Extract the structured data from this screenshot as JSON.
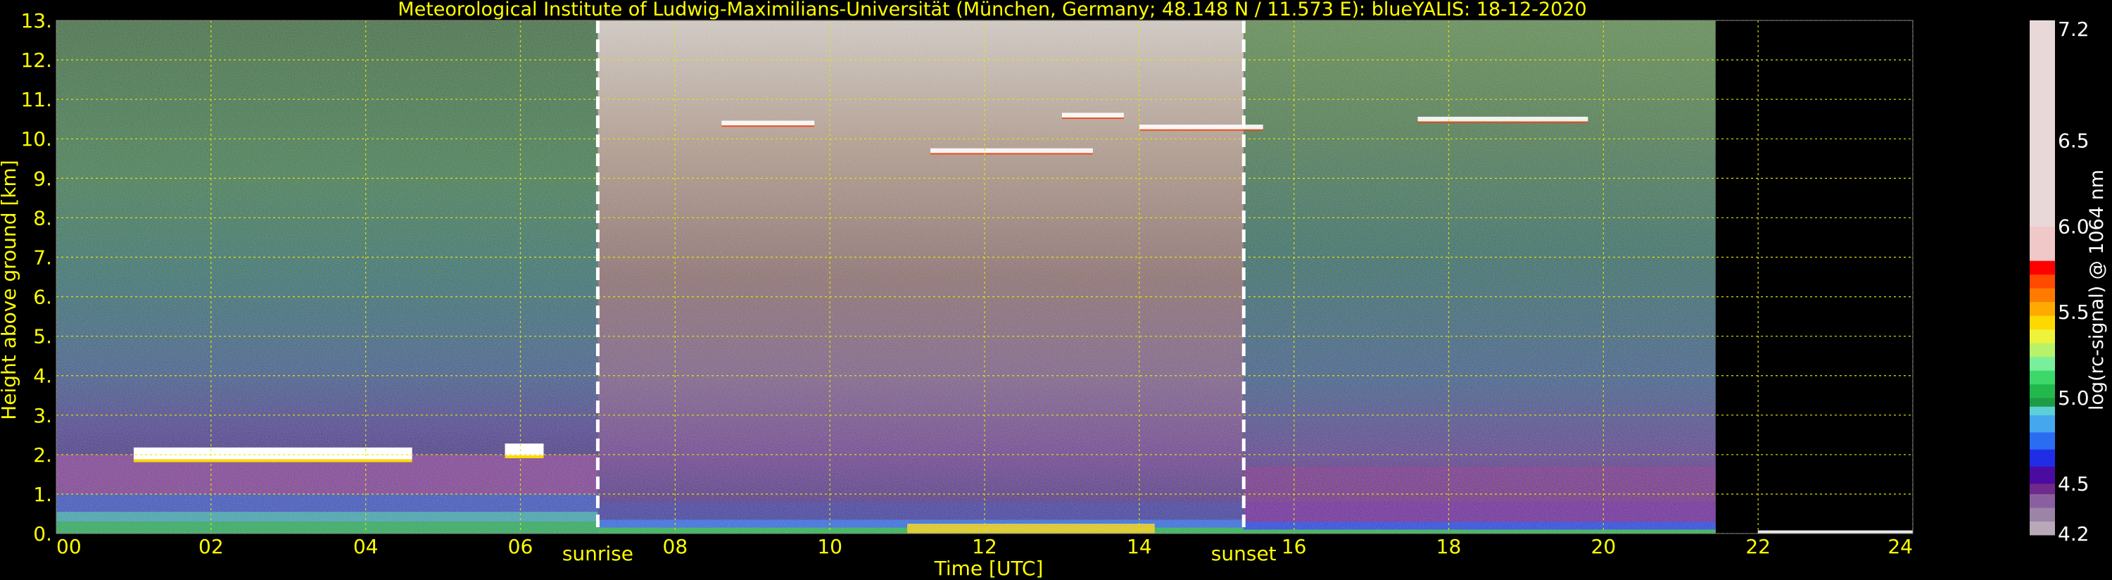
{
  "chart_data": {
    "type": "heatmap",
    "title": "Meteorological Institute of Ludwig-Maximilians-Universität (München, Germany; 48.148 N / 11.573 E):    blueYALIS: 18-12-2020",
    "xlabel": "Time [UTC]",
    "ylabel": "Height above ground [km]",
    "colorbar_label": "log(rc-signal) @ 1064 nm",
    "xlim": [
      0,
      24
    ],
    "ylim": [
      0,
      13
    ],
    "xticks": [
      {
        "v": 0,
        "label": "00"
      },
      {
        "v": 2,
        "label": "02"
      },
      {
        "v": 4,
        "label": "04"
      },
      {
        "v": 6,
        "label": "06"
      },
      {
        "v": 8,
        "label": "08"
      },
      {
        "v": 10,
        "label": "10"
      },
      {
        "v": 12,
        "label": "12"
      },
      {
        "v": 14,
        "label": "14"
      },
      {
        "v": 16,
        "label": "16"
      },
      {
        "v": 18,
        "label": "18"
      },
      {
        "v": 20,
        "label": "20"
      },
      {
        "v": 22,
        "label": "22"
      },
      {
        "v": 24,
        "label": "24"
      }
    ],
    "yticks": [
      {
        "v": 0,
        "label": "0."
      },
      {
        "v": 1,
        "label": "1."
      },
      {
        "v": 2,
        "label": "2."
      },
      {
        "v": 3,
        "label": "3."
      },
      {
        "v": 4,
        "label": "4."
      },
      {
        "v": 5,
        "label": "5."
      },
      {
        "v": 6,
        "label": "6."
      },
      {
        "v": 7,
        "label": "7."
      },
      {
        "v": 8,
        "label": "8."
      },
      {
        "v": 9,
        "label": "9."
      },
      {
        "v": 10,
        "label": "10."
      },
      {
        "v": 11,
        "label": "11."
      },
      {
        "v": 12,
        "label": "12."
      },
      {
        "v": 13,
        "label": "13."
      }
    ],
    "grid": true,
    "markers": [
      {
        "time": 7.0,
        "label": "sunrise"
      },
      {
        "time": 15.35,
        "label": "sunset"
      }
    ],
    "colorbar": {
      "range": [
        4.2,
        7.2
      ],
      "ticks": [
        "4.2",
        "4.5",
        "5.0",
        "5.5",
        "6.0",
        "6.5",
        "7.2"
      ],
      "tick_values": [
        4.2,
        4.5,
        5.0,
        5.5,
        6.0,
        6.5,
        7.2
      ],
      "colors": [
        "#b8a8b8",
        "#9c84a8",
        "#8a5fa0",
        "#702a8c",
        "#4b0aa0",
        "#1f2ee6",
        "#2a6cf2",
        "#45a8ee",
        "#5cd0d6",
        "#1f9a45",
        "#23b84c",
        "#3cd86a",
        "#78ef9a",
        "#b8f26a",
        "#eef23a",
        "#ffd800",
        "#ffaa00",
        "#ff7a00",
        "#ff4a00",
        "#ff0000",
        "#f0c8c8",
        "#e8d8d8",
        "#ffffff"
      ],
      "stop_values": [
        4.2,
        4.28,
        4.36,
        4.44,
        4.5,
        4.6,
        4.7,
        4.8,
        4.9,
        4.95,
        5.0,
        5.08,
        5.16,
        5.24,
        5.32,
        5.4,
        5.48,
        5.56,
        5.64,
        5.72,
        5.8,
        6.0,
        7.2
      ]
    },
    "signal_structure": {
      "noise_color_day": "#e8e2dc",
      "noise_color_night": "#3c8a5a",
      "boundary_layer_night": {
        "top_km": 2.0,
        "color": "#8a3c9a"
      },
      "boundary_layer_day": {
        "top_km": 0.8,
        "color": "#2a6cf2"
      },
      "low_aerosol_layer_color": "#1fb84c",
      "max_signal_color": "#ffd800",
      "clouds_low": [
        {
          "t0": 1.0,
          "t1": 4.6,
          "h": 2.0
        },
        {
          "t0": 5.8,
          "t1": 6.3,
          "h": 2.1
        }
      ],
      "clouds_cirrus": [
        {
          "t0": 8.6,
          "t1": 9.8,
          "h": 10.4
        },
        {
          "t0": 11.3,
          "t1": 13.4,
          "h": 9.7
        },
        {
          "t0": 13.0,
          "t1": 13.8,
          "h": 10.6
        },
        {
          "t0": 14.0,
          "t1": 15.6,
          "h": 10.3
        },
        {
          "t0": 17.6,
          "t1": 19.8,
          "h": 10.5
        }
      ],
      "signal_dropout_after": 21.45
    }
  }
}
